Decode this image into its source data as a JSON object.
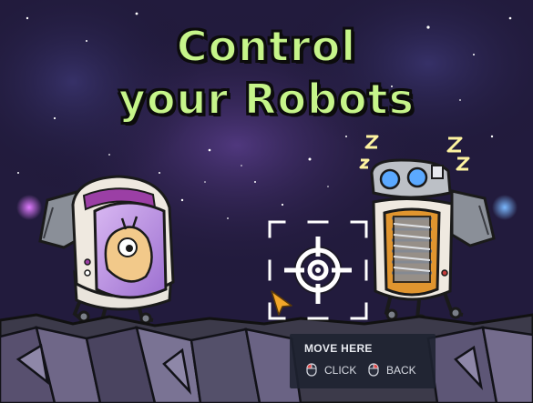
{
  "title": {
    "line1": "Control",
    "line2": "your Robots"
  },
  "hint": {
    "title": "MOVE HERE",
    "actions": [
      {
        "icon": "left-mouse-button-icon",
        "label": "CLICK"
      },
      {
        "icon": "right-mouse-button-icon",
        "label": "BACK"
      }
    ]
  },
  "icons": {
    "target": "crosshair-target-icon",
    "pointer": "arrow-cursor-icon",
    "sleep": "sleeping-zzz-icon"
  },
  "colors": {
    "title_fill": "#c6f58a",
    "title_outline": "#0c0c0c",
    "reticle": "#ffffff",
    "cursor": "#f2a62a",
    "hint_background": "#1e2230",
    "hint_text": "#e6e8ee",
    "mouse_left_highlight": "#e34a4a",
    "sleep_z": "#fdf3a0"
  }
}
